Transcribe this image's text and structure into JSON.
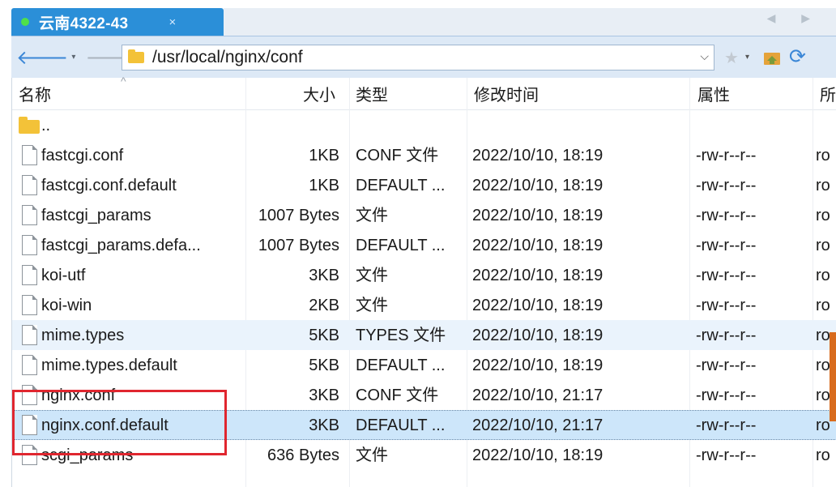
{
  "tab": {
    "title": "云南4322-43",
    "close": "×",
    "scroll": "◀ ▶"
  },
  "toolbar": {
    "back": "🡐",
    "forward": "🡒",
    "caret": "▾",
    "path": "/usr/local/nginx/conf",
    "dropdown": "⌵",
    "star": "★",
    "refresh": "⟳"
  },
  "columns": {
    "name": "名称",
    "size": "大小",
    "type": "类型",
    "modified": "修改时间",
    "attrs": "属性",
    "owner": "所"
  },
  "files": [
    {
      "name": "..",
      "size": "",
      "type": "",
      "modified": "",
      "attrs": "",
      "owner": "",
      "kind": "folder"
    },
    {
      "name": "fastcgi.conf",
      "size": "1KB",
      "type": "CONF 文件",
      "modified": "2022/10/10, 18:19",
      "attrs": "-rw-r--r--",
      "owner": "ro",
      "kind": "file"
    },
    {
      "name": "fastcgi.conf.default",
      "size": "1KB",
      "type": "DEFAULT ...",
      "modified": "2022/10/10, 18:19",
      "attrs": "-rw-r--r--",
      "owner": "ro",
      "kind": "file"
    },
    {
      "name": "fastcgi_params",
      "size": "1007 Bytes",
      "type": "文件",
      "modified": "2022/10/10, 18:19",
      "attrs": "-rw-r--r--",
      "owner": "ro",
      "kind": "file"
    },
    {
      "name": "fastcgi_params.defa...",
      "size": "1007 Bytes",
      "type": "DEFAULT ...",
      "modified": "2022/10/10, 18:19",
      "attrs": "-rw-r--r--",
      "owner": "ro",
      "kind": "file"
    },
    {
      "name": "koi-utf",
      "size": "3KB",
      "type": "文件",
      "modified": "2022/10/10, 18:19",
      "attrs": "-rw-r--r--",
      "owner": "ro",
      "kind": "file"
    },
    {
      "name": "koi-win",
      "size": "2KB",
      "type": "文件",
      "modified": "2022/10/10, 18:19",
      "attrs": "-rw-r--r--",
      "owner": "ro",
      "kind": "file"
    },
    {
      "name": "mime.types",
      "size": "5KB",
      "type": "TYPES 文件",
      "modified": "2022/10/10, 18:19",
      "attrs": "-rw-r--r--",
      "owner": "ro",
      "kind": "file",
      "state": "hover"
    },
    {
      "name": "mime.types.default",
      "size": "5KB",
      "type": "DEFAULT ...",
      "modified": "2022/10/10, 18:19",
      "attrs": "-rw-r--r--",
      "owner": "ro",
      "kind": "file"
    },
    {
      "name": "nginx.conf",
      "size": "3KB",
      "type": "CONF 文件",
      "modified": "2022/10/10, 21:17",
      "attrs": "-rw-r--r--",
      "owner": "ro",
      "kind": "file"
    },
    {
      "name": "nginx.conf.default",
      "size": "3KB",
      "type": "DEFAULT ...",
      "modified": "2022/10/10, 21:17",
      "attrs": "-rw-r--r--",
      "owner": "ro",
      "kind": "file",
      "state": "selected"
    },
    {
      "name": "scgi_params",
      "size": "636 Bytes",
      "type": "文件",
      "modified": "2022/10/10, 18:19",
      "attrs": "-rw-r--r--",
      "owner": "ro",
      "kind": "file"
    }
  ],
  "colors": {
    "tab_active": "#2b8fd8",
    "toolbar": "#dde9f6",
    "hover_row": "#eaf3fc",
    "selected_row": "#cde6fa",
    "annotation": "#e0262f",
    "folder": "#f3c238"
  }
}
